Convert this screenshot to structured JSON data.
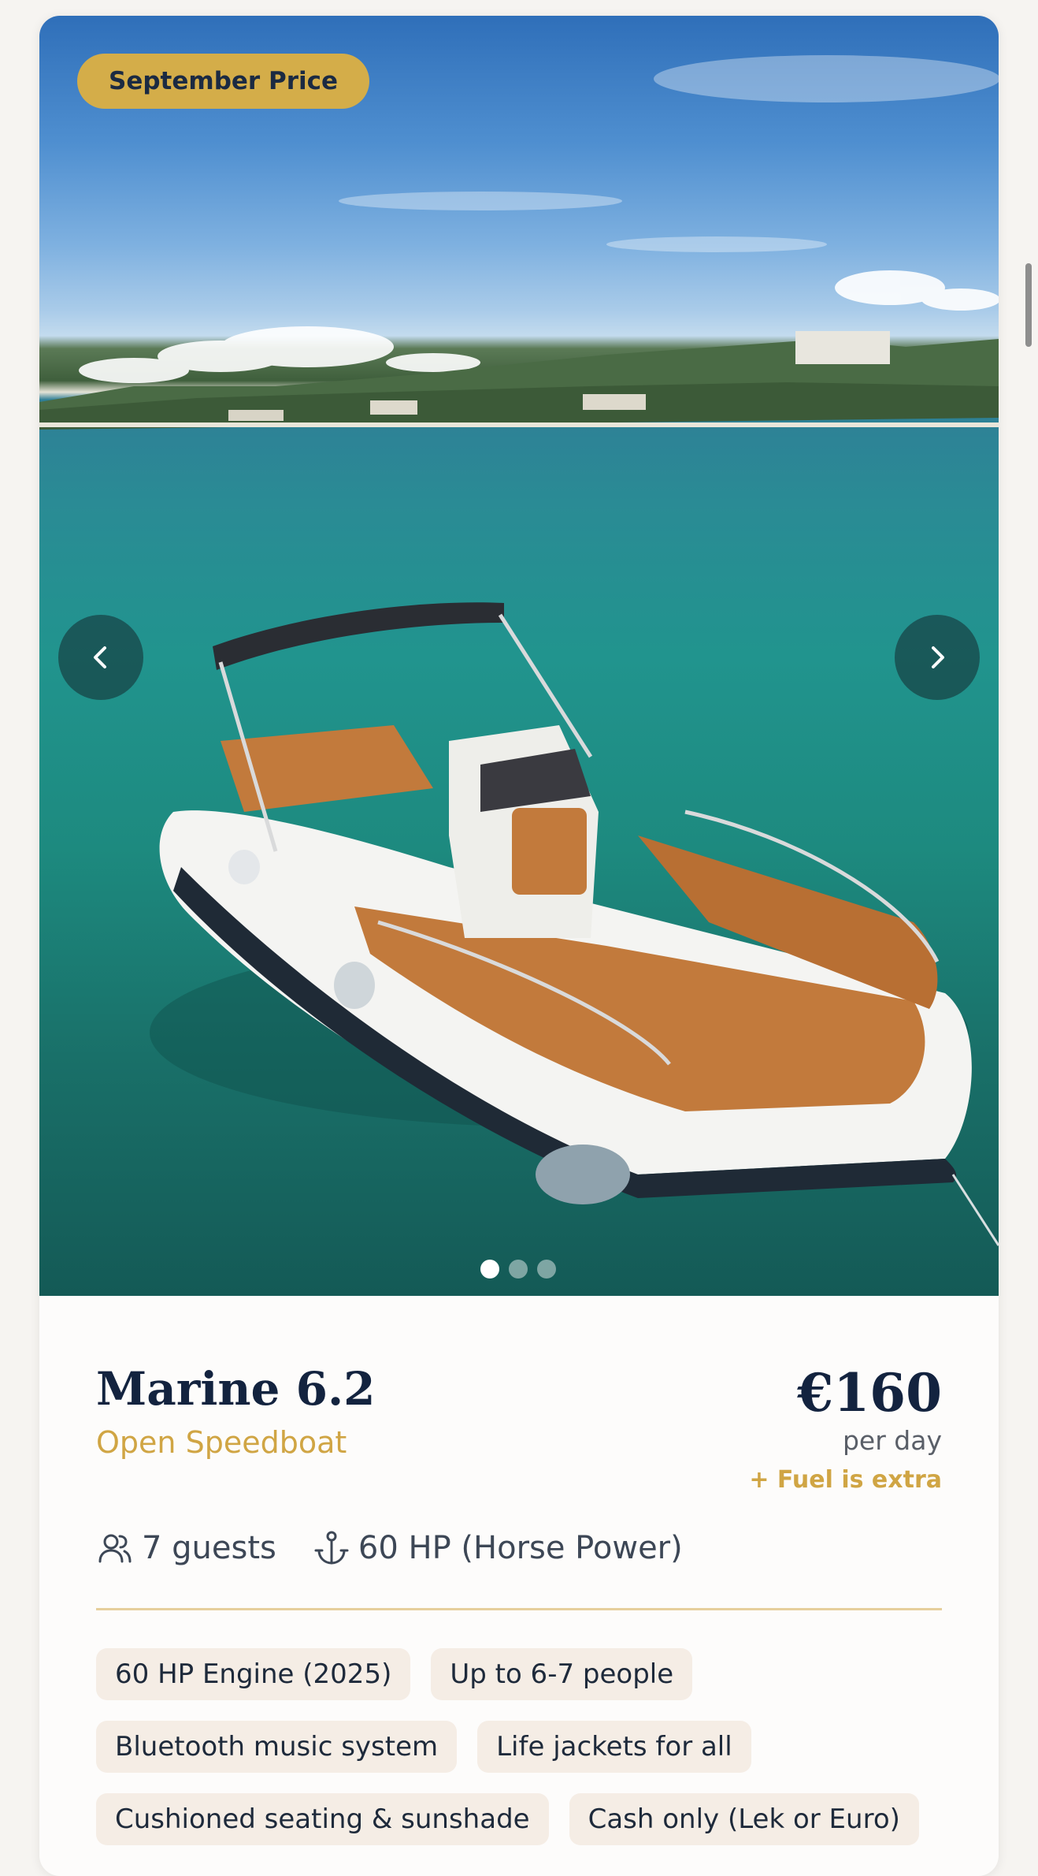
{
  "hero": {
    "badge": "September Price",
    "prev_icon": "chevron-left-icon",
    "next_icon": "chevron-right-icon",
    "carousel": {
      "total": 3,
      "active": 1
    }
  },
  "boat": {
    "name": "Marine 6.2",
    "type": "Open Speedboat",
    "price": "€160",
    "price_unit": "per day",
    "fuel_note": "+ Fuel is extra"
  },
  "specs": {
    "guests": "7 guests",
    "guests_icon": "users-icon",
    "power": "60 HP (Horse Power)",
    "power_icon": "anchor-icon"
  },
  "features": [
    "60 HP Engine (2025)",
    "Up to 6-7 people",
    "Bluetooth music system",
    "Life jackets for all",
    "Cushioned seating & sunshade",
    "Cash only (Lek or Euro)"
  ],
  "colors": {
    "accent_gold": "#d4ad49",
    "title_navy": "#13233f",
    "tag_bg": "#f5ede5"
  }
}
